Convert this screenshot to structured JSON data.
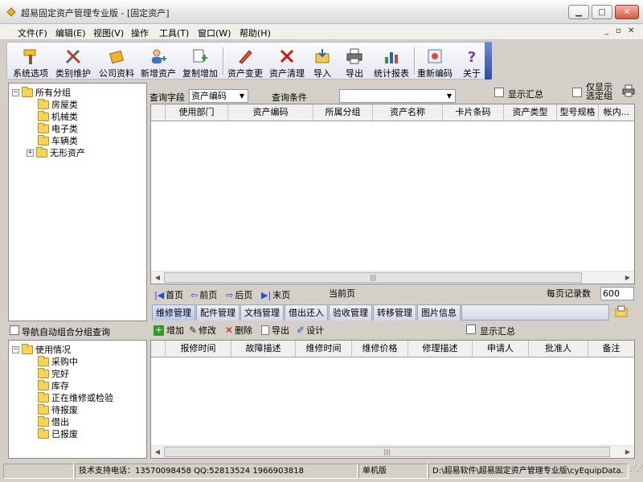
{
  "window": {
    "title": "超易固定资产管理专业版 - [固定资产]",
    "controls": {
      "minimize": "▁",
      "maximize": "□",
      "close": "✕"
    }
  },
  "menu": {
    "items": [
      "文件(F)",
      "编辑(E)",
      "视图(V)",
      "操作",
      "工具(T)",
      "窗口(W)",
      "帮助(H)"
    ],
    "mdi_controls": {
      "minimize": "_",
      "restore": "▫",
      "close": "✕"
    }
  },
  "toolbar": {
    "buttons": [
      {
        "label": "系统选项",
        "icon": "hammer-icon"
      },
      {
        "label": "类别维护",
        "icon": "tools-icon"
      },
      {
        "label": "公司资料",
        "icon": "company-icon"
      },
      {
        "label": "新增资产",
        "icon": "add-user-icon"
      },
      {
        "label": "复制增加",
        "icon": "copy-add-icon"
      },
      {
        "label": "资产变更",
        "icon": "pencil-icon"
      },
      {
        "label": "资产清理",
        "icon": "red-x-icon"
      },
      {
        "label": "导入",
        "icon": "import-icon"
      },
      {
        "label": "导出",
        "icon": "printer-icon"
      },
      {
        "label": "统计报表",
        "icon": "chart-icon"
      },
      {
        "label": "重新编码",
        "icon": "recode-icon"
      },
      {
        "label": "关于",
        "icon": "help-icon"
      }
    ]
  },
  "category_tree": {
    "root": "所有分组",
    "children": [
      "房屋类",
      "机械类",
      "电子类",
      "车辆类",
      "无形资产"
    ]
  },
  "query": {
    "field_label": "查询字段",
    "field_value": "资产编码",
    "condition_label": "查询条件",
    "condition_value": "",
    "show_summary": "显示汇总",
    "only_selected_group_line1": "仅显示",
    "only_selected_group_line2": "选定组"
  },
  "asset_grid": {
    "columns": [
      "使用部门",
      "资产编码",
      "所属分组",
      "资产名称",
      "卡片条码",
      "资产类型",
      "型号规格",
      "帐内..."
    ],
    "rows": []
  },
  "pager": {
    "first": "首页",
    "prev": "前页",
    "next": "后页",
    "last": "末页",
    "current_page_label": "当前页",
    "per_page_label": "每页记录数",
    "per_page_value": "600"
  },
  "nav_auto_group": "导航自动组合分组查询",
  "status_tree": {
    "root": "使用情况",
    "children": [
      "采购中",
      "完好",
      "库存",
      "正在维修或检验",
      "待报废",
      "借出",
      "已报废"
    ]
  },
  "detail_tabs": [
    "维修管理",
    "配件管理",
    "文档管理",
    "借出还入",
    "验收管理",
    "转移管理",
    "图片信息"
  ],
  "detail_toolbar": {
    "add": "增加",
    "edit": "修改",
    "delete": "删除",
    "export": "导出",
    "design": "设计",
    "show_summary": "显示汇总"
  },
  "repair_grid": {
    "columns": [
      "报修时间",
      "故障描述",
      "维修时间",
      "维修价格",
      "修理描述",
      "申请人",
      "批准人",
      "备注"
    ],
    "rows": []
  },
  "status_bar": {
    "support": "技术支持电话：13570098458 QQ:52813524 1966903818",
    "mode": "单机版",
    "path": "D:\\超易软件\\超易固定资产管理专业版\\cyEquipData."
  },
  "colors": {
    "window_bg": "#d4d0c8",
    "toolbar_accent": "#2d4aa8",
    "tab_active": "#b8c8ee"
  }
}
